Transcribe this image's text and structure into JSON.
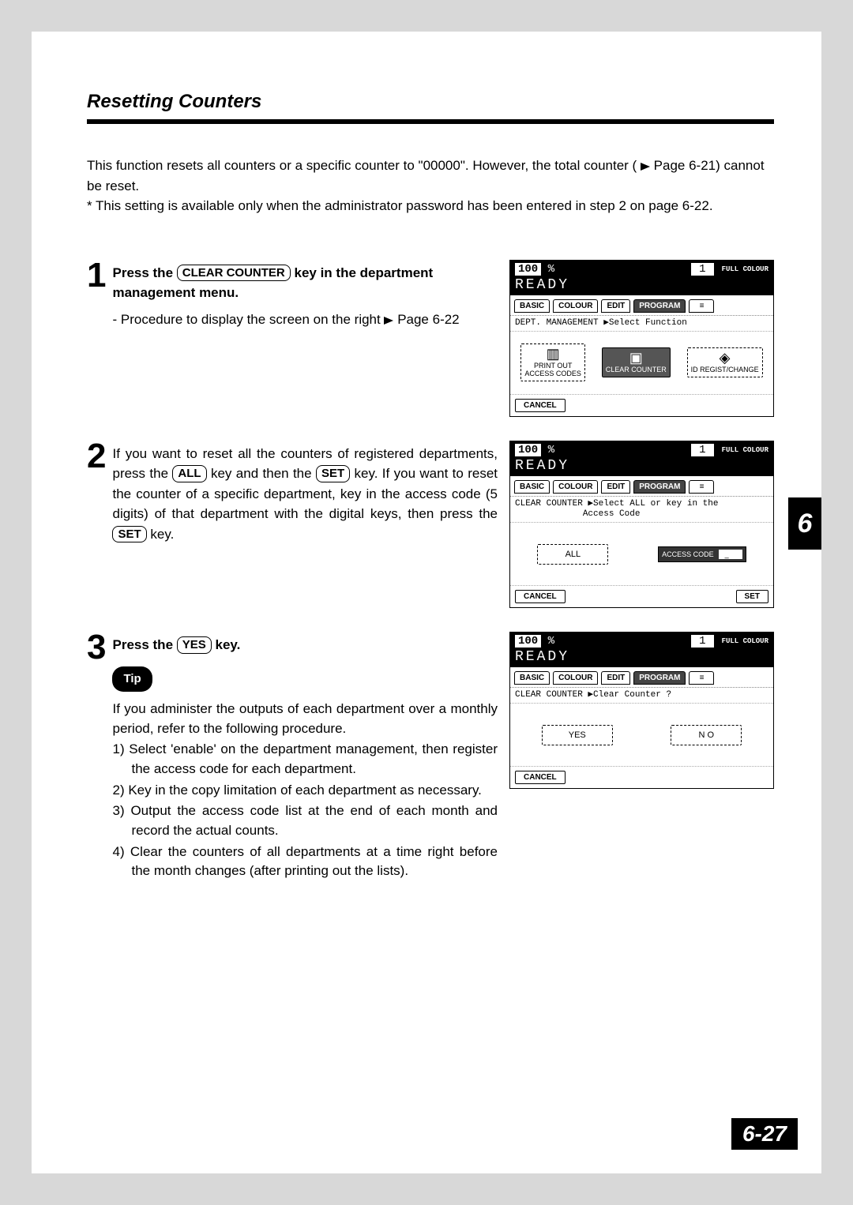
{
  "title": "Resetting Counters",
  "intro_line1": "This function resets all counters or a specific counter to \"00000\".  However, the total counter (",
  "intro_page_ref1": " Page 6-21) cannot be reset.",
  "intro_note": "* This setting is available only when the administrator password has been entered in step 2 on page 6-22.",
  "step1": {
    "num": "1",
    "pre": "Press the ",
    "key": "CLEAR COUNTER",
    "post": " key in the department management menu.",
    "sub": "-  Procedure to display the screen on the right ",
    "sub_ref": " Page 6-22"
  },
  "step2": {
    "num": "2",
    "t1": "If you want to reset all the counters of registered departments, press the ",
    "key_all": "ALL",
    "t2": " key and then the ",
    "key_set1": "SET",
    "t3": " key.  If you want to reset the counter of a specific department, key in the access code (5 digits) of that department with the digital keys, then press the ",
    "key_set2": "SET",
    "t4": " key."
  },
  "step3": {
    "num": "3",
    "pre": "Press the ",
    "key": "YES",
    "post": " key."
  },
  "tip": {
    "label": "Tip",
    "intro": "If you administer the outputs of each department over a monthly period, refer to the following procedure.",
    "l1": "1) Select 'enable' on the department management, then register the access code for each department.",
    "l2": "2) Key in the copy limitation of each department as necessary.",
    "l3": "3) Output the access code list at the end of each month and record the actual counts.",
    "l4": "4) Clear the counters of all departments at a time right before the month changes (after printing out the lists)."
  },
  "screens": {
    "common": {
      "pct": "100",
      "pct_sym": "%",
      "copies": "1",
      "full_colour": "FULL COLOUR",
      "ready": "READY",
      "tabs": {
        "basic": "BASIC",
        "colour": "COLOUR",
        "edit": "EDIT",
        "program": "PROGRAM"
      },
      "cancel": "CANCEL"
    },
    "s1": {
      "subline": "DEPT. MANAGEMENT ▶Select Function",
      "btn1a": "PRINT OUT",
      "btn1b": "ACCESS CODES",
      "btn2": "CLEAR COUNTER",
      "btn3": "ID REGIST/CHANGE"
    },
    "s2": {
      "subline": "CLEAR COUNTER ▶Select ALL or key in the\n             Access Code",
      "btn_all": "ALL",
      "access_label": "ACCESS CODE",
      "access_value": "_",
      "set": "SET"
    },
    "s3": {
      "subline": "CLEAR COUNTER ▶Clear Counter ?",
      "yes": "YES",
      "no": "N O"
    }
  },
  "chapter": "6",
  "page_num": "6-27"
}
